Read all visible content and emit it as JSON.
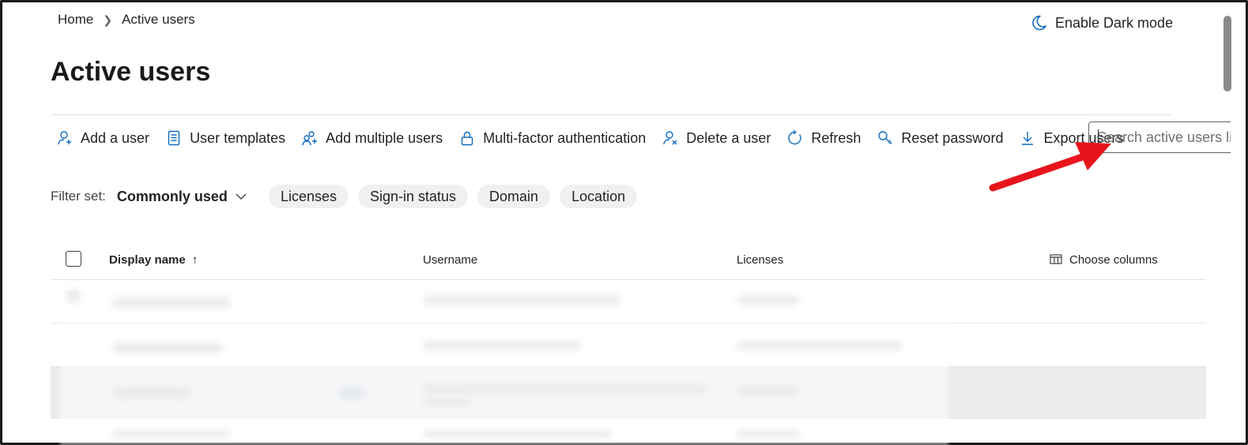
{
  "breadcrumb": {
    "home": "Home",
    "current": "Active users"
  },
  "darkmode": {
    "label": "Enable Dark mode",
    "icon": "moon-icon"
  },
  "page": {
    "title": "Active users"
  },
  "toolbar": {
    "add_user": "Add a user",
    "user_templates": "User templates",
    "add_multiple": "Add multiple users",
    "mfa": "Multi-factor authentication",
    "delete_user": "Delete a user",
    "refresh": "Refresh",
    "reset_password": "Reset password",
    "export_users": "Export users"
  },
  "search": {
    "placeholder": "Search active users list"
  },
  "filters": {
    "label": "Filter set:",
    "set_value": "Commonly used",
    "pills": [
      "Licenses",
      "Sign-in status",
      "Domain",
      "Location"
    ]
  },
  "table": {
    "columns": {
      "display_name": "Display name",
      "username": "Username",
      "licenses": "Licenses"
    },
    "choose_columns": "Choose columns",
    "sort_indicator": "↑"
  },
  "colors": {
    "accent": "#0f6cbd",
    "annotation_arrow": "#e8141c"
  }
}
